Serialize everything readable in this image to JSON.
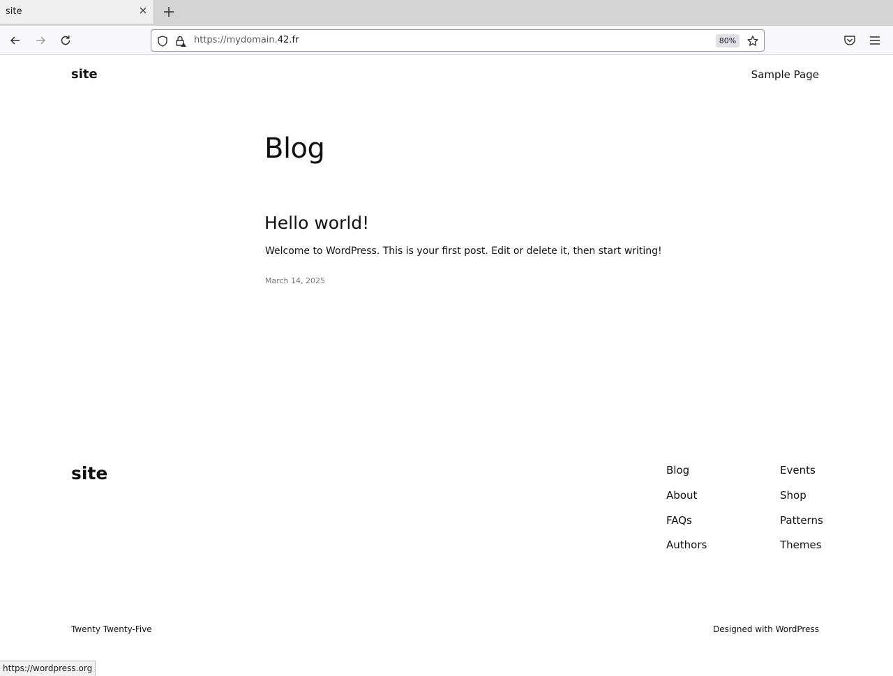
{
  "browser": {
    "tab": {
      "title": "site"
    },
    "url": {
      "prefix": "https://mydomain.",
      "host": "42.fr"
    },
    "zoom": "80%",
    "status_url": "https://wordpress.org"
  },
  "header": {
    "site_title": "site",
    "nav": [
      "Sample Page"
    ]
  },
  "main": {
    "page_title": "Blog",
    "posts": [
      {
        "title": "Hello world!",
        "excerpt": "Welcome to WordPress. This is your first post. Edit or delete it, then start writing!",
        "date": "March 14, 2025"
      }
    ]
  },
  "footer": {
    "site_title": "site",
    "nav_col1": [
      "Blog",
      "About",
      "FAQs",
      "Authors"
    ],
    "nav_col2": [
      "Events",
      "Shop",
      "Patterns",
      "Themes"
    ],
    "theme_name": "Twenty Twenty-Five",
    "credit_prefix": "Designed with ",
    "credit_link": "WordPress"
  }
}
